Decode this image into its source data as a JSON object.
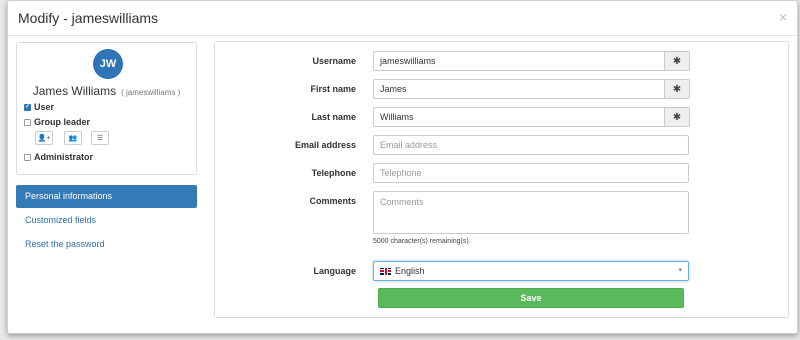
{
  "modal": {
    "title": "Modify - jameswilliams",
    "close_label": "×"
  },
  "user": {
    "initials": "JW",
    "full_name": "James Williams",
    "login": "( jameswilliams )",
    "roles": [
      {
        "label": "User",
        "checked": true
      },
      {
        "label": "Group leader",
        "checked": false
      },
      {
        "label": "Administrator",
        "checked": false
      }
    ],
    "icon_buttons": [
      "add-user-icon",
      "group-icon",
      "list-icon"
    ]
  },
  "nav": {
    "items": [
      {
        "label": "Personal informations",
        "active": true
      },
      {
        "label": "Customized fields",
        "active": false
      },
      {
        "label": "Reset the password",
        "active": false
      }
    ]
  },
  "form": {
    "username": {
      "label": "Username",
      "value": "jameswilliams",
      "addon": "✱"
    },
    "first_name": {
      "label": "First name",
      "value": "James",
      "addon": "✱"
    },
    "last_name": {
      "label": "Last name",
      "value": "Williams",
      "addon": "✱"
    },
    "email": {
      "label": "Email address",
      "placeholder": "Email address"
    },
    "telephone": {
      "label": "Telephone",
      "placeholder": "Telephone"
    },
    "comments": {
      "label": "Comments",
      "placeholder": "Comments",
      "remaining": "5000 character(s) remaining(s)."
    },
    "language": {
      "label": "Language",
      "value": "English",
      "caret": "▾"
    },
    "save_label": "Save"
  },
  "colors": {
    "primary": "#337ab7",
    "success": "#5cb85c",
    "avatar": "#2f74b4"
  }
}
